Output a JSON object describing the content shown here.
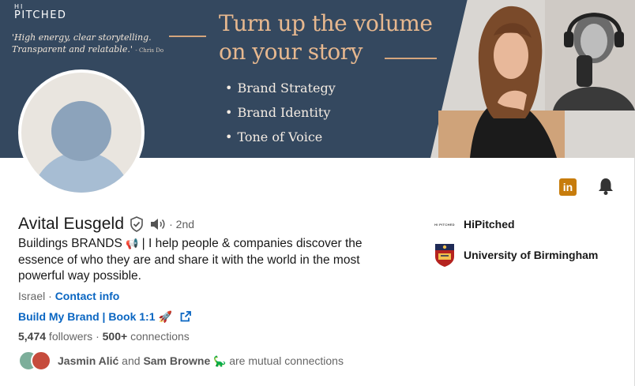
{
  "banner": {
    "logo_hi": "HI",
    "logo_text": "PITCHED",
    "quote": "'High energy, clear storytelling. Transparent and relatable.'",
    "quote_author": "- Chris Do",
    "headline_line1": "Turn up the volume",
    "headline_line2": "on your story",
    "bullets": [
      "Brand Strategy",
      "Brand Identity",
      "Tone of Voice"
    ]
  },
  "profile": {
    "name": "Avital Eusgeld",
    "degree": "· 2nd",
    "headline_part1": "Buildings BRANDS",
    "headline_part2": "| I help people & companies discover the essence of who they are and share it with the world in the most powerful way possible.",
    "location": "Israel",
    "location_sep": " · ",
    "contact_info": "Contact info",
    "link_label": "Build My Brand | Book 1:1",
    "followers_count": "5,474",
    "followers_label": " followers",
    "stats_sep": "  · ",
    "connections_count": "500+",
    "connections_label": " connections",
    "mutual_name1": "Jasmin Alić",
    "mutual_and": " and ",
    "mutual_name2": "Sam Browne",
    "mutual_suffix": " are mutual connections"
  },
  "orgs": [
    {
      "name": "HiPitched",
      "logo_text": "HI PITCHED"
    },
    {
      "name": "University of Birmingham"
    }
  ],
  "icons": {
    "linkedin": "in",
    "megaphone": "📢",
    "rocket": "🚀",
    "dino": "🦕"
  },
  "colors": {
    "banner_bg": "#34485f",
    "accent_gold": "#e7b88f",
    "link_blue": "#0a66c2",
    "linkedin_orange": "#c77c0c"
  }
}
